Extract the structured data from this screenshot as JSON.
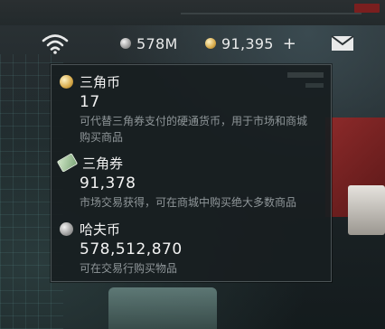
{
  "header": {
    "currency1_value": "578M",
    "currency2_value": "91,395",
    "add_label": "+"
  },
  "tooltip": {
    "entries": [
      {
        "name": "三角币",
        "value": "17",
        "description": "可代替三角券支付的硬通货币，用于市场和商城购买商品",
        "icon": "gold-coin-icon"
      },
      {
        "name": "三角券",
        "value": "91,378",
        "description": "市场交易获得，可在商城中购买绝大多数商品",
        "icon": "ticket-icon"
      },
      {
        "name": "哈夫币",
        "value": "578,512,870",
        "description": "可在交易行购买物品",
        "icon": "silver-coin-icon"
      }
    ]
  },
  "colors": {
    "text_primary": "#f0f0f0",
    "text_secondary": "#8f9699",
    "panel_bg": "#181e20",
    "gold": "#d7aa4a",
    "silver": "#9c9c9c"
  }
}
